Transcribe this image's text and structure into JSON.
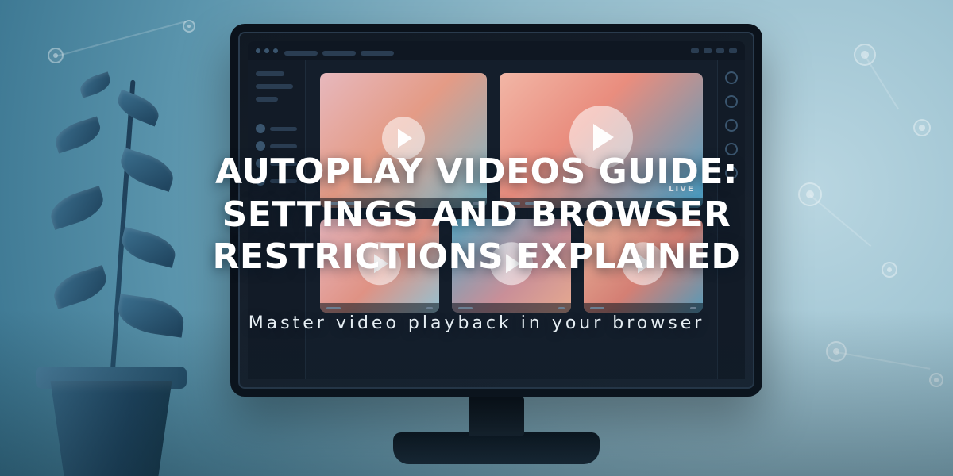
{
  "hero": {
    "title": "AUTOPLAY VIDEOS GUIDE: SETTINGS AND BROWSER RESTRICTIONS EXPLAINED",
    "subtitle": "Master video playback in your browser"
  },
  "monitor": {
    "live_badge": "LIVE"
  }
}
